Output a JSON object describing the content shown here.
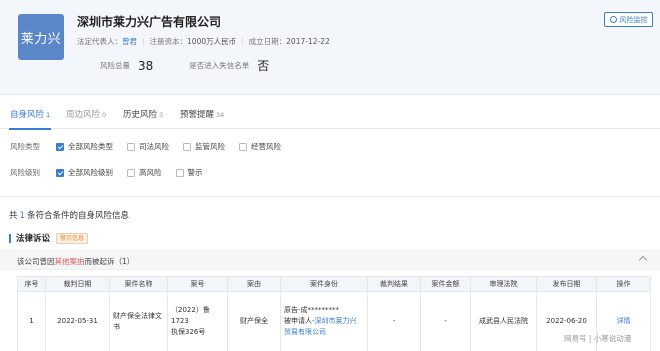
{
  "company": {
    "logo_text": "莱力兴",
    "name": "深圳市莱力兴广告有限公司",
    "legal_rep_label": "法定代表人：",
    "legal_rep": "曾君",
    "capital_label": "注册资本：",
    "capital": "1000万人民币",
    "founded_label": "成立日期：",
    "founded": "2017-12-22",
    "risk_total_label": "风险总量",
    "risk_total": "38",
    "dishonest_label": "是否进入失信名单",
    "dishonest": "否",
    "monitor_button": "风险监控"
  },
  "tabs": [
    {
      "label": "自身风险",
      "count": "1"
    },
    {
      "label": "周边风险",
      "count": "0"
    },
    {
      "label": "历史风险",
      "count": "3"
    },
    {
      "label": "预警提醒",
      "count": "34"
    }
  ],
  "filters": {
    "type_label": "风险类型",
    "type_options": [
      "全部风险类型",
      "司法风险",
      "监管风险",
      "经营风险"
    ],
    "level_label": "风险级别",
    "level_options": [
      "全部风险级别",
      "高风险",
      "警示"
    ]
  },
  "summary": {
    "prefix": "共",
    "count": "1",
    "suffix": "条符合条件的自身风险信息"
  },
  "section": {
    "title": "法律诉讼",
    "badge": "警示信息"
  },
  "subhead": {
    "pre": "该公司曾因",
    "highlight": "其他案由",
    "post": "而被起诉（1）"
  },
  "table": {
    "headers": [
      "序号",
      "裁判日期",
      "案件名称",
      "案号",
      "案由",
      "案件身份",
      "裁判结果",
      "案件金额",
      "审理法院",
      "发布日期",
      "操作"
    ],
    "row": {
      "index": "1",
      "date": "2022-05-31",
      "name_l1": "财产保全法律文",
      "name_l2": "书",
      "case_no_l1": "（2022）鲁1723",
      "case_no_l2": "执保326号",
      "cause": "财产保全",
      "role_l1": "原告-成*********",
      "role_l2_pre": "被申请人-",
      "role_l2_link": "深圳市莱力兴",
      "role_l3": "贸易有限公司",
      "result": "-",
      "amount": "-",
      "court": "成武县人民法院",
      "publish": "2022-06-20",
      "action": "详情"
    }
  },
  "watermark": "网易号 | 小寒说动漫"
}
